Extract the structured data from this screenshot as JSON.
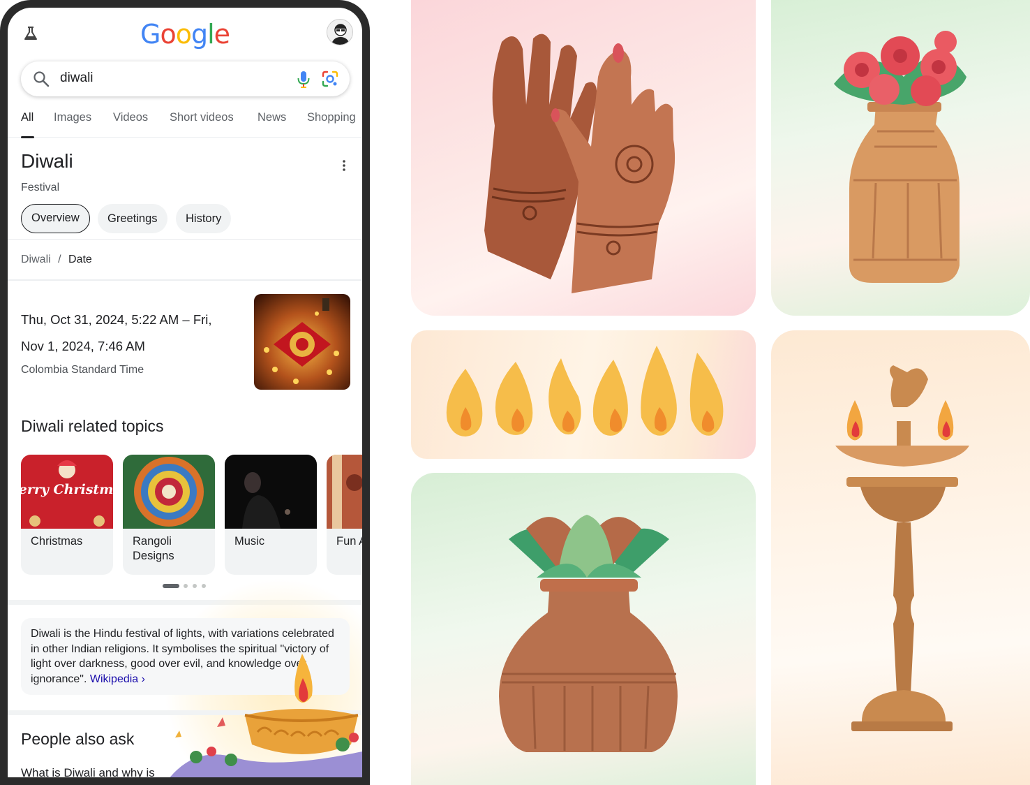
{
  "search": {
    "query": "diwali"
  },
  "logo": {
    "letters": [
      "G",
      "o",
      "o",
      "g",
      "l",
      "e"
    ],
    "colors": [
      "#4285F4",
      "#EA4335",
      "#FBBC05",
      "#4285F4",
      "#34A853",
      "#EA4335"
    ]
  },
  "tabs": [
    {
      "label": "All",
      "active": true
    },
    {
      "label": "Images"
    },
    {
      "label": "Videos"
    },
    {
      "label": "Short videos"
    },
    {
      "label": "News"
    },
    {
      "label": "Shopping"
    }
  ],
  "knowledge_panel": {
    "title": "Diwali",
    "subtitle": "Festival",
    "chips": [
      "Overview",
      "Greetings",
      "History"
    ],
    "breadcrumb": {
      "parent": "Diwali",
      "separator": "/",
      "current": "Date"
    },
    "date_line1": "Thu, Oct 31, 2024, 5:22 AM – Fri,",
    "date_line2": "Nov 1, 2024, 7:46 AM",
    "timezone": "Colombia Standard Time"
  },
  "related": {
    "title": "Diwali related topics",
    "topics": [
      {
        "label": "Christmas",
        "image_text": "merry Christmas"
      },
      {
        "label": "Rangoli Designs"
      },
      {
        "label": "Music"
      },
      {
        "label": "Fun Activ"
      }
    ]
  },
  "description": {
    "text": "Diwali is the Hindu festival of lights, with variations celebrated in other Indian religions. It symbolises the spiritual \"victory of light over darkness, good over evil, and knowledge over ignorance\". ",
    "link": "Wikipedia ›"
  },
  "people_also_ask": {
    "title": "People also ask",
    "first_question": "What is Diwali and why is"
  },
  "colors": {
    "accent_blue": "#1a0dab",
    "tile_pink": "#fde3e4",
    "tile_green": "#e3f2e1",
    "tile_peach": "#fdebd6",
    "terracotta": "#b8714e"
  }
}
